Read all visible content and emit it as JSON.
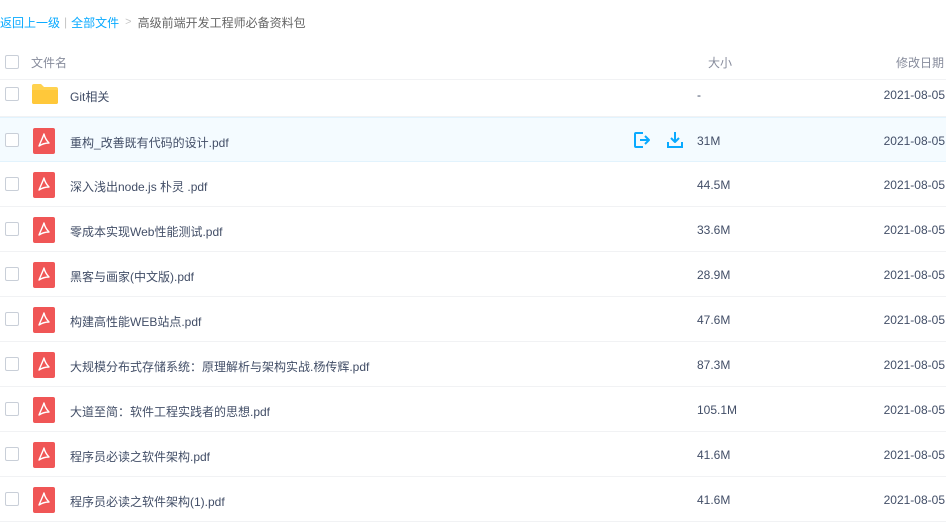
{
  "breadcrumb": {
    "back": "返回上一级",
    "sep": "|",
    "all_files": "全部文件",
    "arrow": ">",
    "current": "高级前端开发工程师必备资料包"
  },
  "header": {
    "name": "文件名",
    "size": "大小",
    "date": "修改日期"
  },
  "files": [
    {
      "name": "Git相关",
      "size": "-",
      "date": "2021-08-05",
      "type": "folder-icon"
    },
    {
      "name": "重构_改善既有代码的设计.pdf",
      "size": "31M",
      "date": "2021-08-05",
      "type": "pdf-icon"
    },
    {
      "name": "深入浅出node.js 朴灵 .pdf",
      "size": "44.5M",
      "date": "2021-08-05",
      "type": "pdf-icon"
    },
    {
      "name": "零成本实现Web性能测试.pdf",
      "size": "33.6M",
      "date": "2021-08-05",
      "type": "pdf-icon"
    },
    {
      "name": "黑客与画家(中文版).pdf",
      "size": "28.9M",
      "date": "2021-08-05",
      "type": "pdf-icon"
    },
    {
      "name": "构建高性能WEB站点.pdf",
      "size": "47.6M",
      "date": "2021-08-05",
      "type": "pdf-icon"
    },
    {
      "name": "大规模分布式存储系统：原理解析与架构实战.杨传辉.pdf",
      "size": "87.3M",
      "date": "2021-08-05",
      "type": "pdf-icon"
    },
    {
      "name": "大道至简：软件工程实践者的思想.pdf",
      "size": "105.1M",
      "date": "2021-08-05",
      "type": "pdf-icon"
    },
    {
      "name": "程序员必读之软件架构.pdf",
      "size": "41.6M",
      "date": "2021-08-05",
      "type": "pdf-icon"
    },
    {
      "name": "程序员必读之软件架构(1).pdf",
      "size": "41.6M",
      "date": "2021-08-05",
      "type": "pdf-icon"
    }
  ],
  "hover_actions": [
    "share-icon",
    "download-icon"
  ],
  "colors": {
    "link": "#09aaff",
    "pdf": "#f05656",
    "folder": "#ffd24f",
    "action": "#09aaff"
  }
}
